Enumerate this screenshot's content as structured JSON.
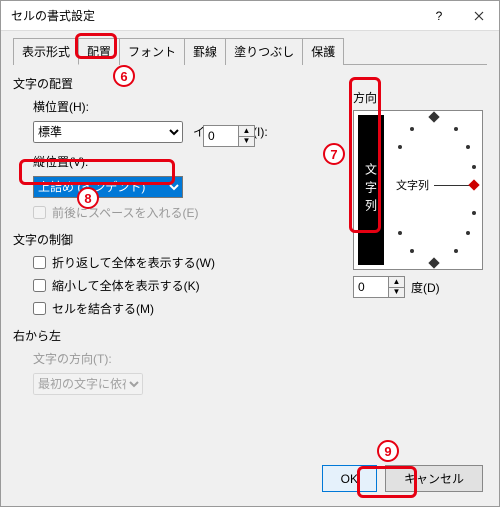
{
  "window": {
    "title": "セルの書式設定"
  },
  "tabs": [
    "表示形式",
    "配置",
    "フォント",
    "罫線",
    "塗りつぶし",
    "保護"
  ],
  "active_tab_index": 1,
  "alignment": {
    "section_label": "文字の配置",
    "horizontal_label": "横位置(H):",
    "horizontal_value": "標準",
    "indent_label": "インデント(I):",
    "indent_value": "0",
    "vertical_label": "縦位置(V):",
    "vertical_value": "上詰め (インデント)",
    "distribute_label": "前後にスペースを入れる(E)"
  },
  "control": {
    "section_label": "文字の制御",
    "wrap_label": "折り返して全体を表示する(W)",
    "shrink_label": "縮小して全体を表示する(K)",
    "merge_label": "セルを結合する(M)"
  },
  "rtl": {
    "section_label": "右から左",
    "direction_label": "文字の方向(T):",
    "direction_value": "最初の文字に依存"
  },
  "orientation": {
    "section_label": "方向",
    "vertical_text": "文字列",
    "horizontal_text": "文字列",
    "degree_value": "0",
    "degree_label": "度(D)"
  },
  "buttons": {
    "ok": "OK",
    "cancel": "キャンセル"
  },
  "annotations": {
    "n6": "6",
    "n7": "7",
    "n8": "8",
    "n9": "9"
  }
}
